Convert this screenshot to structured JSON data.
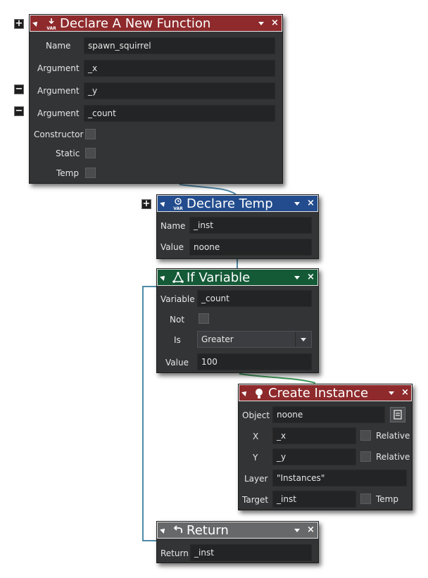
{
  "declare_function": {
    "title": "Declare A New Function",
    "icon": "var-declare-icon",
    "rows": [
      {
        "label": "Name",
        "value": "spawn_squirrel"
      },
      {
        "label": "Argument",
        "value": "_x"
      },
      {
        "label": "Argument",
        "value": "_y"
      },
      {
        "label": "Argument",
        "value": "_count"
      }
    ],
    "checks": [
      {
        "label": "Constructor"
      },
      {
        "label": "Static"
      },
      {
        "label": "Temp"
      }
    ],
    "add_symbol": "+",
    "remove_symbol": "−",
    "close_symbol": "×"
  },
  "declare_temp": {
    "title": "Declare Temp",
    "icon": "timer-var-icon",
    "name_label": "Name",
    "name_value": "_inst",
    "value_label": "Value",
    "value_value": "noone",
    "add_symbol": "+",
    "close_symbol": "×"
  },
  "if_variable": {
    "title": "If Variable",
    "icon": "branch-icon",
    "variable_label": "Variable",
    "variable_value": "_count",
    "not_label": "Not",
    "is_label": "Is",
    "is_value": "Greater",
    "value_label": "Value",
    "value_value": "100",
    "close_symbol": "×"
  },
  "create_instance": {
    "title": "Create Instance",
    "icon": "lightbulb-icon",
    "object_label": "Object",
    "object_value": "noone",
    "x_label": "X",
    "x_value": "_x",
    "x_relative": "Relative",
    "y_label": "Y",
    "y_value": "_y",
    "y_relative": "Relative",
    "layer_label": "Layer",
    "layer_value": "\"Instances\"",
    "target_label": "Target",
    "target_value": "_inst",
    "target_temp": "Temp",
    "close_symbol": "×"
  },
  "return_block": {
    "title": "Return",
    "icon": "return-icon",
    "return_label": "Return",
    "return_value": "_inst",
    "close_symbol": "×"
  },
  "colors": {
    "function_header": "#8e2a2c",
    "temp_header": "#224c8d",
    "if_header": "#145a37",
    "return_header": "#66686a",
    "wire": "#4f8aa8",
    "wire_green": "#3f9a5a"
  }
}
